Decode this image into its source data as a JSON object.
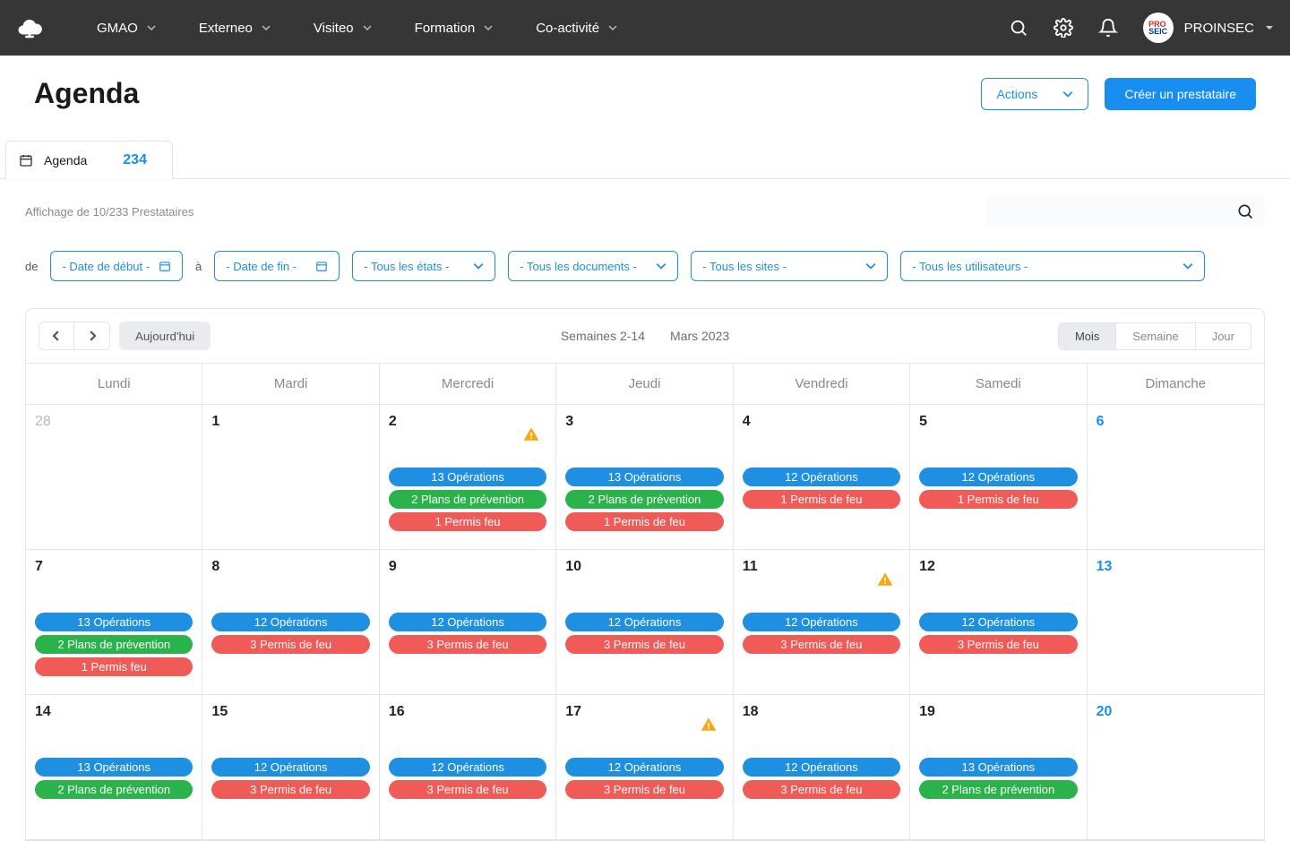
{
  "nav": {
    "items": [
      "GMAO",
      "Externeo",
      "Visiteo",
      "Formation",
      "Co-activité"
    ],
    "user": "PROINSEC"
  },
  "page": {
    "title": "Agenda",
    "actions_btn": "Actions",
    "create_btn": "Créer un prestataire",
    "tab_label": "Agenda",
    "tab_count": "234",
    "results_text": "Affichage de 10/233 Prestataires"
  },
  "filters": {
    "de": "de",
    "a": "à",
    "start": "- Date de début -",
    "end": "- Date de fin -",
    "states": "- Tous les états -",
    "docs": "- Tous les documents -",
    "sites": "- Tous les sites -",
    "users": "- Tous les utilisateurs -"
  },
  "calendar": {
    "weeks_label": "Semaines 2-14",
    "month_label": "Mars 2023",
    "today": "Aujourd'hui",
    "views": [
      "Mois",
      "Semaine",
      "Jour"
    ],
    "dayheads": [
      "Lundi",
      "Mardi",
      "Mercredi",
      "Jeudi",
      "Vendredi",
      "Samedi",
      "Dimanche"
    ],
    "cells": [
      {
        "num": "28",
        "muted": true
      },
      {
        "num": "1"
      },
      {
        "num": "2",
        "warn": true,
        "pills": [
          {
            "c": "blue",
            "t": "13 Opérations"
          },
          {
            "c": "green",
            "t": "2 Plans de prévention"
          },
          {
            "c": "red",
            "t": "1 Permis feu"
          }
        ]
      },
      {
        "num": "3",
        "pills": [
          {
            "c": "blue",
            "t": "13 Opérations"
          },
          {
            "c": "green",
            "t": "2 Plans de prévention"
          },
          {
            "c": "red",
            "t": "1 Permis de feu"
          }
        ]
      },
      {
        "num": "4",
        "pills": [
          {
            "c": "blue",
            "t": "12 Opérations"
          },
          {
            "c": "red",
            "t": "1 Permis de feu"
          }
        ]
      },
      {
        "num": "5",
        "pills": [
          {
            "c": "blue",
            "t": "12 Opérations"
          },
          {
            "c": "red",
            "t": "1 Permis de feu"
          }
        ]
      },
      {
        "num": "6",
        "blue": true
      },
      {
        "num": "7",
        "pills": [
          {
            "c": "blue",
            "t": "13 Opérations"
          },
          {
            "c": "green",
            "t": "2 Plans de prévention"
          },
          {
            "c": "red",
            "t": "1 Permis feu"
          }
        ]
      },
      {
        "num": "8",
        "pills": [
          {
            "c": "blue",
            "t": "12 Opérations"
          },
          {
            "c": "red",
            "t": "3 Permis de feu"
          }
        ]
      },
      {
        "num": "9",
        "pills": [
          {
            "c": "blue",
            "t": "12 Opérations"
          },
          {
            "c": "red",
            "t": "3 Permis de feu"
          }
        ]
      },
      {
        "num": "10",
        "pills": [
          {
            "c": "blue",
            "t": "12 Opérations"
          },
          {
            "c": "red",
            "t": "3 Permis de feu"
          }
        ]
      },
      {
        "num": "11",
        "warn": true,
        "pills": [
          {
            "c": "blue",
            "t": "12 Opérations"
          },
          {
            "c": "red",
            "t": "3 Permis de feu"
          }
        ]
      },
      {
        "num": "12",
        "pills": [
          {
            "c": "blue",
            "t": "12 Opérations"
          },
          {
            "c": "red",
            "t": "3 Permis de feu"
          }
        ]
      },
      {
        "num": "13",
        "blue": true
      },
      {
        "num": "14",
        "pills": [
          {
            "c": "blue",
            "t": "13 Opérations"
          },
          {
            "c": "green",
            "t": "2 Plans de prévention"
          }
        ]
      },
      {
        "num": "15",
        "pills": [
          {
            "c": "blue",
            "t": "12 Opérations"
          },
          {
            "c": "red",
            "t": "3 Permis de feu"
          }
        ]
      },
      {
        "num": "16",
        "pills": [
          {
            "c": "blue",
            "t": "12 Opérations"
          },
          {
            "c": "red",
            "t": "3 Permis de feu"
          }
        ]
      },
      {
        "num": "17",
        "warn": true,
        "pills": [
          {
            "c": "blue",
            "t": "12 Opérations"
          },
          {
            "c": "red",
            "t": "3 Permis de feu"
          }
        ]
      },
      {
        "num": "18",
        "pills": [
          {
            "c": "blue",
            "t": "12 Opérations"
          },
          {
            "c": "red",
            "t": "3 Permis de feu"
          }
        ]
      },
      {
        "num": "19",
        "pills": [
          {
            "c": "blue",
            "t": "13 Opérations"
          },
          {
            "c": "green",
            "t": "2 Plans de prévention"
          }
        ]
      },
      {
        "num": "20",
        "blue": true
      }
    ]
  }
}
